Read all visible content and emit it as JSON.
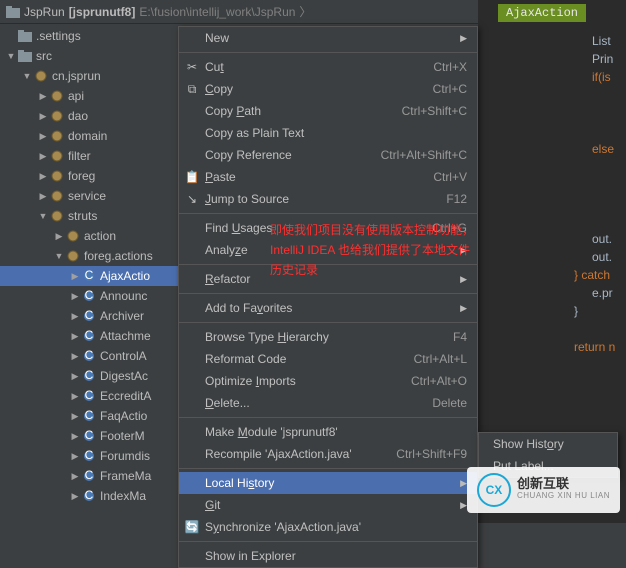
{
  "breadcrumb": {
    "project": "JspRun",
    "module": "[jsprunutf8]",
    "path": "E:\\fusion\\intellij_work\\JspRun"
  },
  "tab_highlight": "AjaxAction",
  "sidebar": {
    "items": [
      {
        "indent": 0,
        "arrow": "none",
        "icon": "dir",
        "label": ".settings"
      },
      {
        "indent": 0,
        "arrow": "down",
        "icon": "dir",
        "label": "src"
      },
      {
        "indent": 1,
        "arrow": "down",
        "icon": "pkg",
        "label": "cn.jsprun"
      },
      {
        "indent": 2,
        "arrow": "right",
        "icon": "pkg",
        "label": "api"
      },
      {
        "indent": 2,
        "arrow": "right",
        "icon": "pkg",
        "label": "dao"
      },
      {
        "indent": 2,
        "arrow": "right",
        "icon": "pkg",
        "label": "domain"
      },
      {
        "indent": 2,
        "arrow": "right",
        "icon": "pkg",
        "label": "filter"
      },
      {
        "indent": 2,
        "arrow": "right",
        "icon": "pkg",
        "label": "foreg"
      },
      {
        "indent": 2,
        "arrow": "right",
        "icon": "pkg",
        "label": "service"
      },
      {
        "indent": 2,
        "arrow": "down",
        "icon": "pkg",
        "label": "struts"
      },
      {
        "indent": 3,
        "arrow": "right",
        "icon": "pkg",
        "label": "action"
      },
      {
        "indent": 3,
        "arrow": "down",
        "icon": "pkg",
        "label": "foreg.actions"
      },
      {
        "indent": 4,
        "arrow": "right",
        "icon": "class",
        "label": "AjaxActio",
        "selected": true
      },
      {
        "indent": 4,
        "arrow": "right",
        "icon": "class",
        "label": "Announc"
      },
      {
        "indent": 4,
        "arrow": "right",
        "icon": "class",
        "label": "Archiver"
      },
      {
        "indent": 4,
        "arrow": "right",
        "icon": "class",
        "label": "Attachme"
      },
      {
        "indent": 4,
        "arrow": "right",
        "icon": "class",
        "label": "ControlA"
      },
      {
        "indent": 4,
        "arrow": "right",
        "icon": "class",
        "label": "DigestAc"
      },
      {
        "indent": 4,
        "arrow": "right",
        "icon": "class",
        "label": "EccreditA"
      },
      {
        "indent": 4,
        "arrow": "right",
        "icon": "class",
        "label": "FaqActio"
      },
      {
        "indent": 4,
        "arrow": "right",
        "icon": "class",
        "label": "FooterM"
      },
      {
        "indent": 4,
        "arrow": "right",
        "icon": "class",
        "label": "Forumdis"
      },
      {
        "indent": 4,
        "arrow": "right",
        "icon": "class",
        "label": "FrameMa"
      },
      {
        "indent": 4,
        "arrow": "right",
        "icon": "class",
        "label": "IndexMa"
      }
    ]
  },
  "context_menu": [
    {
      "type": "item",
      "label": "New",
      "sub": true,
      "icon": ""
    },
    {
      "type": "sep"
    },
    {
      "type": "item",
      "label": "Cut",
      "u": 2,
      "shortcut": "Ctrl+X",
      "icon": "✂"
    },
    {
      "type": "item",
      "label": "Copy",
      "u": 0,
      "shortcut": "Ctrl+C",
      "icon": "⧉"
    },
    {
      "type": "item",
      "label": "Copy Path",
      "u": 5,
      "shortcut": "Ctrl+Shift+C",
      "icon": ""
    },
    {
      "type": "item",
      "label": "Copy as Plain Text",
      "icon": ""
    },
    {
      "type": "item",
      "label": "Copy Reference",
      "shortcut": "Ctrl+Alt+Shift+C",
      "icon": ""
    },
    {
      "type": "item",
      "label": "Paste",
      "u": 0,
      "shortcut": "Ctrl+V",
      "icon": "📋"
    },
    {
      "type": "item",
      "label": "Jump to Source",
      "u": 0,
      "shortcut": "F12",
      "icon": "↘"
    },
    {
      "type": "sep"
    },
    {
      "type": "item",
      "label": "Find Usages",
      "u": 5,
      "shortcut": "Ctrl+G",
      "icon": ""
    },
    {
      "type": "item",
      "label": "Analyze",
      "u": 5,
      "sub": true,
      "icon": ""
    },
    {
      "type": "sep"
    },
    {
      "type": "item",
      "label": "Refactor",
      "u": 0,
      "sub": true,
      "icon": ""
    },
    {
      "type": "sep"
    },
    {
      "type": "item",
      "label": "Add to Favorites",
      "u": 9,
      "sub": true,
      "icon": ""
    },
    {
      "type": "sep"
    },
    {
      "type": "item",
      "label": "Browse Type Hierarchy",
      "u": 12,
      "shortcut": "F4",
      "icon": ""
    },
    {
      "type": "item",
      "label": "Reformat Code",
      "shortcut": "Ctrl+Alt+L",
      "icon": ""
    },
    {
      "type": "item",
      "label": "Optimize Imports",
      "u": 9,
      "shortcut": "Ctrl+Alt+O",
      "icon": ""
    },
    {
      "type": "item",
      "label": "Delete...",
      "u": 0,
      "shortcut": "Delete",
      "icon": ""
    },
    {
      "type": "sep"
    },
    {
      "type": "item",
      "label": "Make Module 'jsprunutf8'",
      "u": 5,
      "icon": ""
    },
    {
      "type": "item",
      "label": "Recompile 'AjaxAction.java'",
      "shortcut": "Ctrl+Shift+F9",
      "icon": ""
    },
    {
      "type": "sep"
    },
    {
      "type": "item",
      "label": "Local History",
      "u": 8,
      "sub": true,
      "highlighted": true,
      "icon": ""
    },
    {
      "type": "item",
      "label": "Git",
      "u": 0,
      "sub": true,
      "icon": ""
    },
    {
      "type": "item",
      "label": "Synchronize 'AjaxAction.java'",
      "u": 1,
      "icon": "🔄"
    },
    {
      "type": "sep"
    },
    {
      "type": "item",
      "label": "Show in Explorer",
      "icon": ""
    }
  ],
  "submenu": [
    {
      "label": "Show History",
      "u": 9
    },
    {
      "label": "Put Label..."
    }
  ],
  "code_lines": [
    {
      "t": "List",
      "cls": ""
    },
    {
      "t": "Prin",
      "cls": ""
    },
    {
      "t": "if(is",
      "cls": "kw"
    },
    {
      "t": "",
      "cls": ""
    },
    {
      "t": "",
      "cls": ""
    },
    {
      "t": "",
      "cls": ""
    },
    {
      "t": "else",
      "cls": "kw"
    },
    {
      "t": "",
      "cls": ""
    },
    {
      "t": "",
      "cls": ""
    },
    {
      "t": "",
      "cls": ""
    },
    {
      "t": "",
      "cls": ""
    },
    {
      "t": "out.",
      "cls": ""
    },
    {
      "t": "out.",
      "cls": ""
    },
    {
      "t": "} catch",
      "cls": "kw",
      "off": -18
    },
    {
      "t": "e.pr",
      "cls": ""
    },
    {
      "t": "}",
      "cls": "",
      "off": -18
    },
    {
      "t": "",
      "cls": ""
    },
    {
      "t": "return n",
      "cls": "kw",
      "off": -18
    }
  ],
  "annotation": {
    "line1": "即使我们项目没有使用版本控制功能，",
    "line2": "IntelliJ IDEA 也给我们提供了本地文件",
    "line3": "历史记录"
  },
  "logo": {
    "cn": "创新互联",
    "py": "CHUANG XIN HU LIAN"
  }
}
